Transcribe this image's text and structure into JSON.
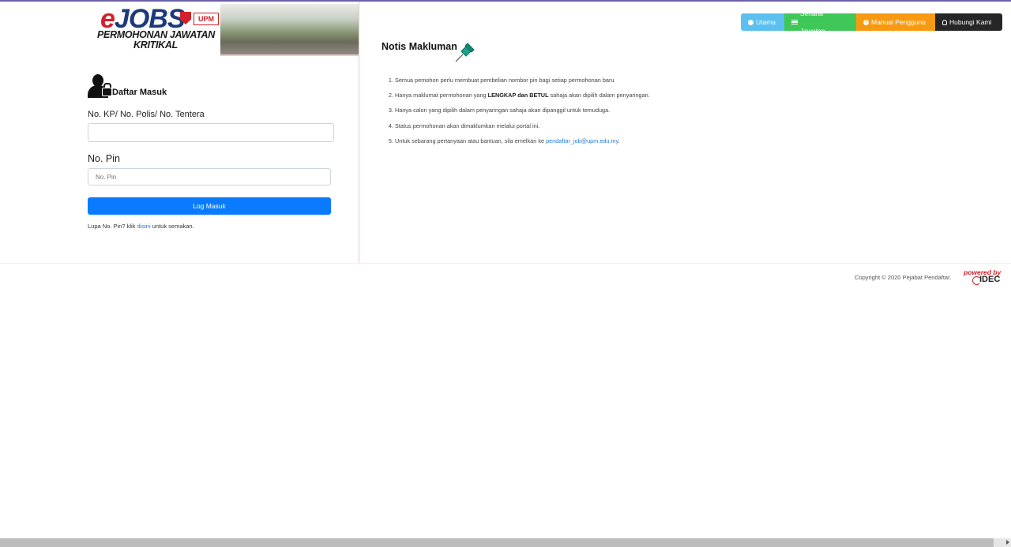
{
  "brand": {
    "logo_e": "e",
    "logo_jobs": "JOBS",
    "upm": "UPM",
    "subtitle_line1": "PERMOHONAN JAWATAN",
    "subtitle_line2": "KRITIKAL"
  },
  "login": {
    "title": "Daftar Masuk",
    "kp_label": "No. KP/ No. Polis/ No. Tentera",
    "kp_value": "",
    "pin_label": "No. Pin",
    "pin_placeholder": "No. Pin",
    "submit_label": "Log Masuk",
    "forgot_prefix": "Lupa No. Pin? klik ",
    "forgot_link": "disini",
    "forgot_suffix": " untuk semakan."
  },
  "nav": {
    "items": [
      {
        "label": "Utama",
        "icon": "globe-icon",
        "color": "#5bc0f0"
      },
      {
        "label": "Senarai Jawatan",
        "icon": "list-icon",
        "color": "#40c75a"
      },
      {
        "label": "Manual Pengguna",
        "icon": "info-icon",
        "color": "#f79a12"
      },
      {
        "label": "Hubungi Kami",
        "icon": "user-icon",
        "color": "#262626"
      }
    ]
  },
  "notis": {
    "title": "Notis Makluman",
    "item1": "Semua pemohon perlu membuat pembelian nombor pin bagi setiap permohonan baru",
    "item2_prefix": "Hanya maklumat permohonan yang ",
    "item2_bold": "LENGKAP dan BETUL",
    "item2_suffix": " sahaja akan dipilih dalam penyaringan.",
    "item3": "Hanya calon yang dipilih dalam penyaringan sahaja akan dipanggil untuk temuduga.",
    "item4": "Status permohonan akan dimaklumkan melalui portal ini.",
    "item5_prefix": "Untuk sebarang pertanyaan atau bantuan, sila emelkan ke ",
    "item5_link": "pendaftar_job@upm.edu.my",
    "item5_suffix": "."
  },
  "footer": {
    "copyright": "Copyright © 2020 Pejabat Pendaftar.",
    "powered_by": "powered by",
    "idec": "IDEC"
  },
  "colors": {
    "primary": "#0a7bff",
    "brand_red": "#d4202a",
    "brand_blue": "#1c3a7a"
  }
}
